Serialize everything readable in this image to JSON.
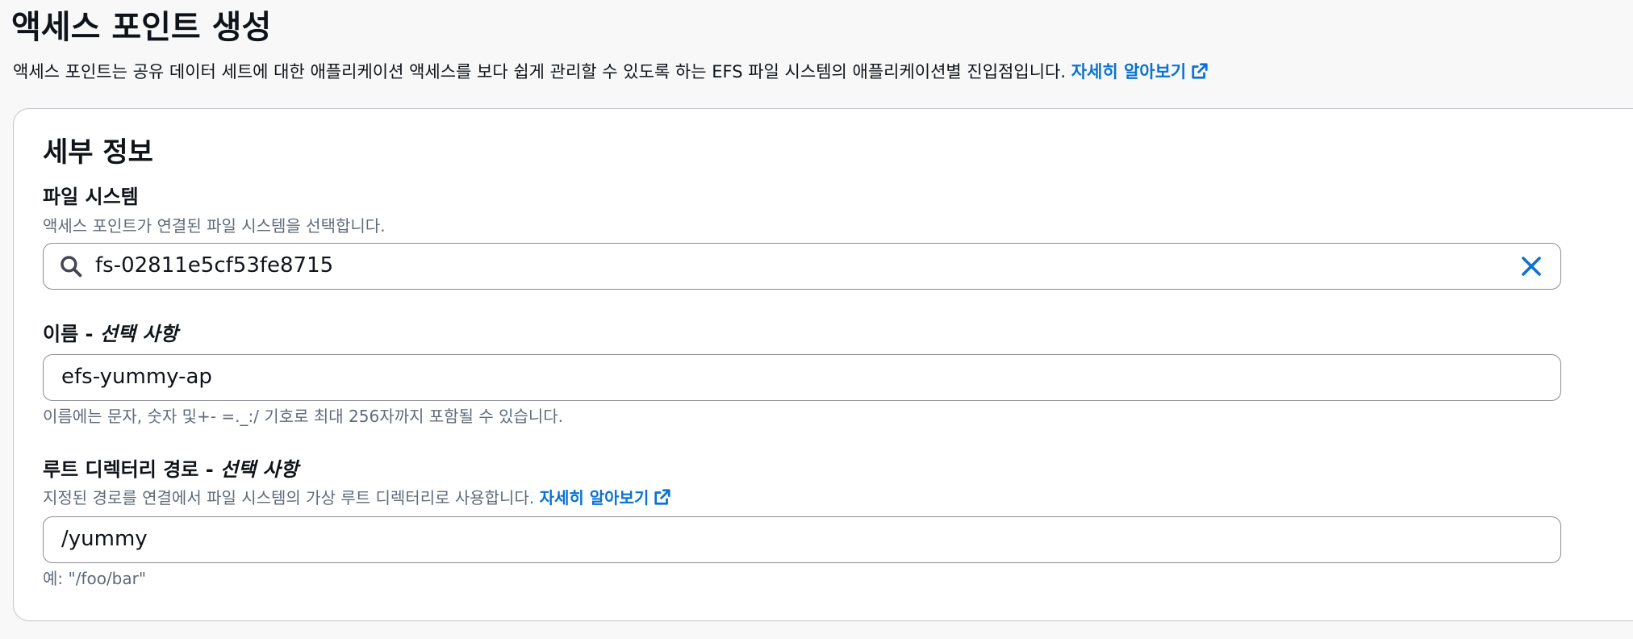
{
  "page": {
    "title": "액세스 포인트 생성",
    "description": "액세스 포인트는 공유 데이터 세트에 대한 애플리케이션 액세스를 보다 쉽게 관리할 수 있도록 하는 EFS 파일 시스템의 애플리케이션별 진입점입니다.",
    "learn_more": "자세히 알아보기"
  },
  "details": {
    "title": "세부 정보",
    "file_system": {
      "label": "파일 시스템",
      "hint": "액세스 포인트가 연결된 파일 시스템을 선택합니다.",
      "value": "fs-02811e5cf53fe8715",
      "search_icon": "search-icon",
      "clear_icon": "close-icon"
    },
    "name": {
      "label": "이름 - ",
      "optional": "선택 사항",
      "value": "efs-yummy-ap",
      "hint": "이름에는 문자, 숫자 및+- =._:/ 기호로 최대 256자까지 포함될 수 있습니다."
    },
    "root_path": {
      "label": "루트 디렉터리 경로 - ",
      "optional": "선택 사항",
      "hint": "지정된 경로를 연결에서 파일 시스템의 가상 루트 디렉터리로 사용합니다.",
      "learn_more": "자세히 알아보기",
      "value": "/yummy",
      "example": "예: \"/foo/bar\""
    }
  },
  "colors": {
    "link": "#0972d3",
    "hint_text": "#5f6b7a",
    "border": "#8c8c94",
    "background": "#f8f8f8"
  }
}
